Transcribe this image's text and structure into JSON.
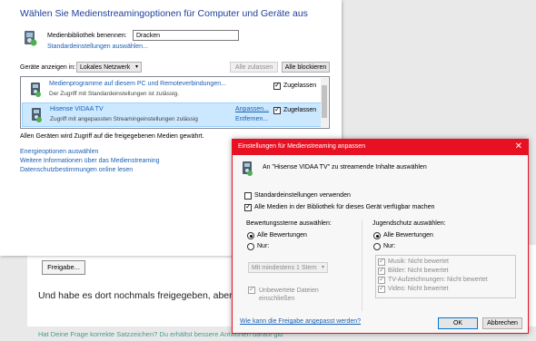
{
  "forum": {
    "button_label": "Freigabe...",
    "body_text": "Und habe es dort nochmals freigegeben, aber nicht",
    "bottom_link": "Hat Deine Frage korrekte Satzzeichen? Du erhältst bessere Antworten darauf gib"
  },
  "main": {
    "title": "Wählen Sie Medienstreamingoptionen für Computer und Geräte aus",
    "library_label": "Medienbibliothek benennen:",
    "library_value": "Dracken",
    "default_settings_link": "Standardeinstellungen auswählen...",
    "show_devices_label": "Geräte anzeigen in:",
    "network_select": "Lokales Netzwerk",
    "allow_all_button": "Alle zulassen",
    "block_all_button": "Alle blockieren",
    "devices": [
      {
        "name": "Medienprogramme auf diesem PC und Remoteverbindungen...",
        "sub": "Der Zugriff mit Standardeinstellungen ist zulässig.",
        "action1": "",
        "action2": "",
        "allowed_label": "Zugelassen",
        "allowed": true
      },
      {
        "name": "Hisense VIDAA TV",
        "sub": "Zugriff mit angepassten Streamingeinstellungen zulässig",
        "action1": "Anpassen...",
        "action2": "Entfernen...",
        "allowed_label": "Zugelassen",
        "allowed": true
      }
    ],
    "status_text": "Allen Geräten wird Zugriff auf die freigegebenen Medien gewährt.",
    "links": [
      "Energieoptionen auswählen",
      "Weitere Informationen über das Medienstreaming",
      "Datenschutzbestimmungen online lesen"
    ]
  },
  "dialog": {
    "title": "Einstellungen für Medienstreaming anpassen",
    "heading": "An \"Hisense VIDAA TV\" zu streamende Inhalte auswählen",
    "use_default_label": "Standardeinstellungen verwenden",
    "use_default_checked": false,
    "all_media_label": "Alle Medien in der Bibliothek für dieses Gerät verfügbar machen",
    "all_media_checked": true,
    "ratings_heading": "Bewertungssterne auswählen:",
    "ratings_all": "Alle Bewertungen",
    "ratings_only": "Nur:",
    "ratings_select": "Mit mindestens 1 Stern",
    "unrated_label": "Unbewertete Dateien einschließen",
    "parental_heading": "Jugendschutz auswählen:",
    "parental_all": "Alle Bewertungen",
    "parental_only": "Nur:",
    "parental_items": [
      "Musik: Nicht bewertet",
      "Bilder: Nicht bewertet",
      "TV-Aufzeichnungen: Nicht bewertet",
      "Video: Nicht bewertet"
    ],
    "help_link": "Wie kann die Freigabe angepasst werden?",
    "ok_button": "OK",
    "cancel_button": "Abbrechen",
    "close_glyph": "✕"
  },
  "colors": {
    "accent_red": "#e81123",
    "link_blue": "#1a5fb4",
    "title_blue": "#1e3f9c",
    "selection_blue": "#cce8ff"
  }
}
